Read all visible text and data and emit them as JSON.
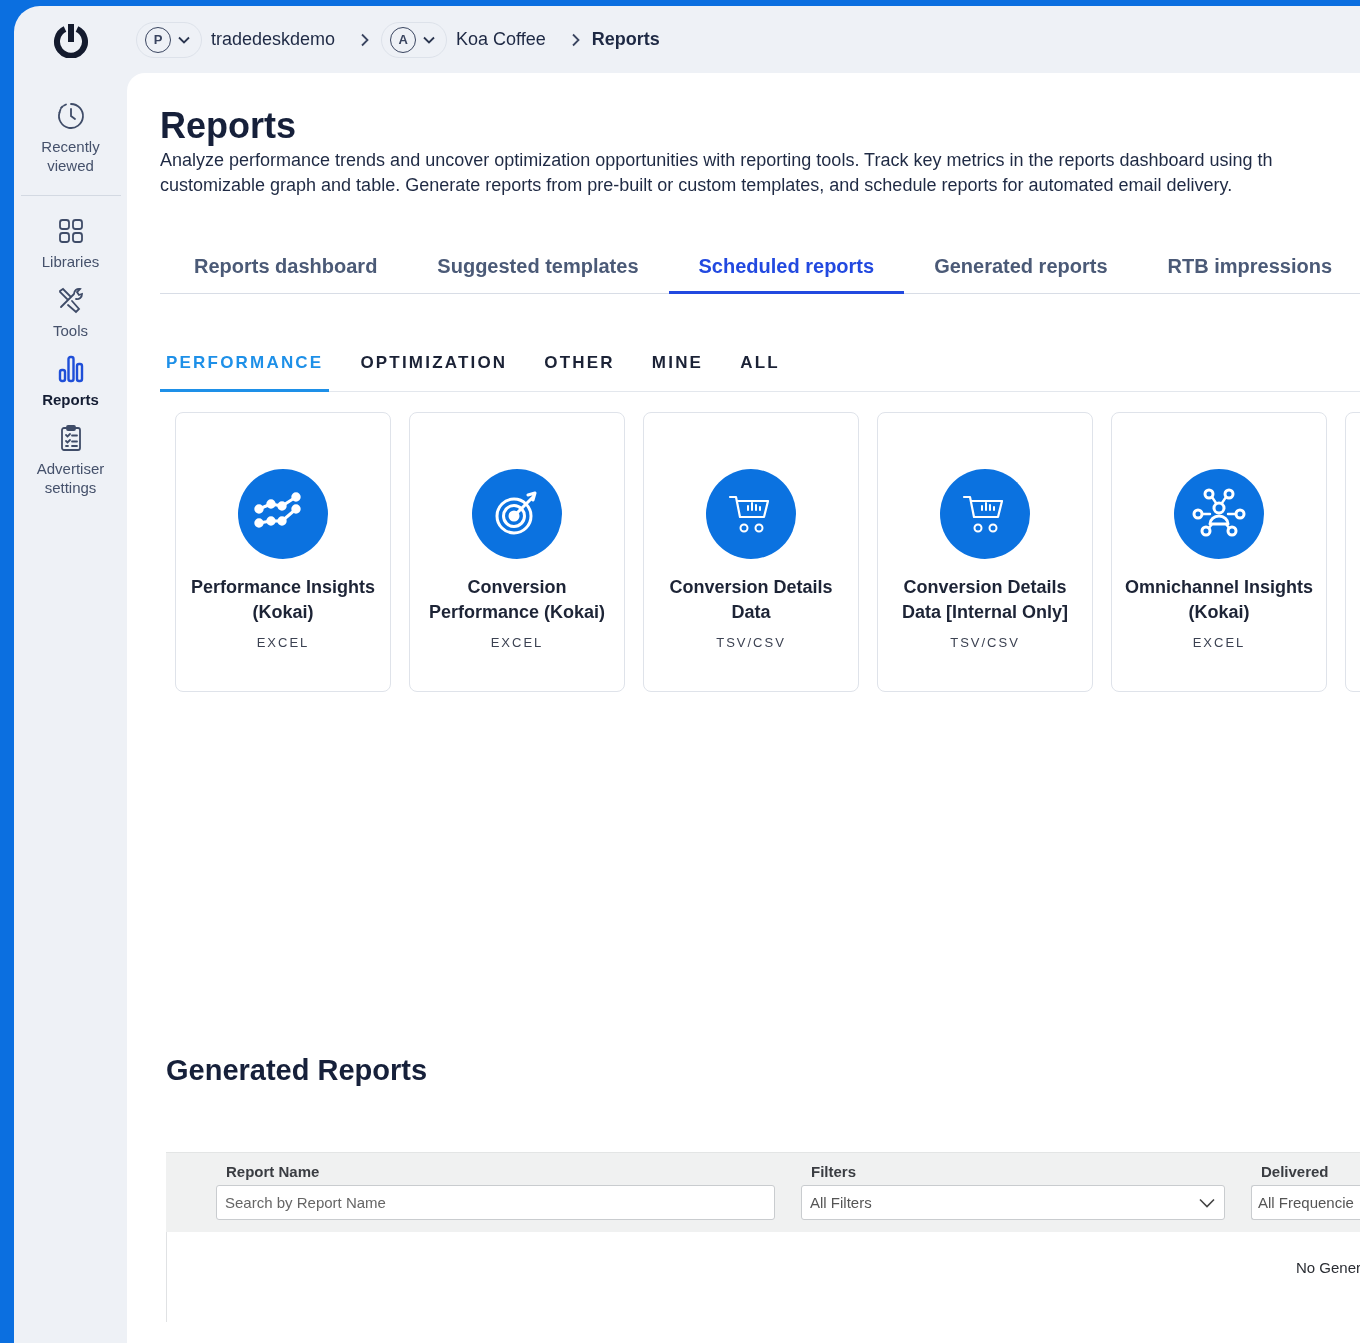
{
  "breadcrumb": [
    {
      "kind": "picker",
      "badge": "P",
      "label": "tradedeskdemo"
    },
    {
      "kind": "picker",
      "badge": "A",
      "label": "Koa Coffee"
    },
    {
      "kind": "current",
      "label": "Reports"
    }
  ],
  "sidebar": {
    "items": [
      {
        "kind": "clock",
        "label": "Recently viewed",
        "selected": false
      },
      {
        "kind": "grid",
        "label": "Libraries",
        "selected": false
      },
      {
        "kind": "tools",
        "label": "Tools",
        "selected": false
      },
      {
        "kind": "bars",
        "label": "Reports",
        "selected": true
      },
      {
        "kind": "clipboard",
        "label": "Advertiser settings",
        "selected": false
      }
    ]
  },
  "page": {
    "title": "Reports",
    "description_lines": [
      "Analyze performance trends and uncover optimization opportunities with reporting tools. Track key metrics in the reports dashboard using th",
      "customizable graph and table. Generate reports from pre-built or custom templates, and schedule reports for automated email delivery."
    ]
  },
  "tabs": [
    {
      "label": "Reports dashboard",
      "selected": false
    },
    {
      "label": "Suggested templates",
      "selected": false
    },
    {
      "label": "Scheduled reports",
      "selected": true
    },
    {
      "label": "Generated reports",
      "selected": false
    },
    {
      "label": "RTB impressions",
      "selected": false
    }
  ],
  "subtabs": [
    {
      "label": "PERFORMANCE",
      "selected": true
    },
    {
      "label": "OPTIMIZATION",
      "selected": false
    },
    {
      "label": "OTHER",
      "selected": false
    },
    {
      "label": "MINE",
      "selected": false
    },
    {
      "label": "ALL",
      "selected": false
    }
  ],
  "templates": [
    {
      "kind": "trend",
      "title": "Performance Insights (Kokai)",
      "format": "EXCEL"
    },
    {
      "kind": "target",
      "title": "Conversion Performance (Kokai)",
      "format": "EXCEL"
    },
    {
      "kind": "cart",
      "title": "Conversion Details Data",
      "format": "TSV/CSV"
    },
    {
      "kind": "cart",
      "title": "Conversion Details Data [Internal Only]",
      "format": "TSV/CSV"
    },
    {
      "kind": "network",
      "title": "Omnichannel Insights (Kokai)",
      "format": "EXCEL"
    }
  ],
  "generated_reports": {
    "title": "Generated Reports",
    "filters": [
      {
        "kind": "search",
        "label": "Report Name",
        "placeholder": "Search by Report Name"
      },
      {
        "kind": "select",
        "label": "Filters",
        "value": "All Filters"
      },
      {
        "kind": "select_cut",
        "label": "Delivered",
        "value": "All Frequencie"
      }
    ],
    "empty_message": "No Gener"
  }
}
